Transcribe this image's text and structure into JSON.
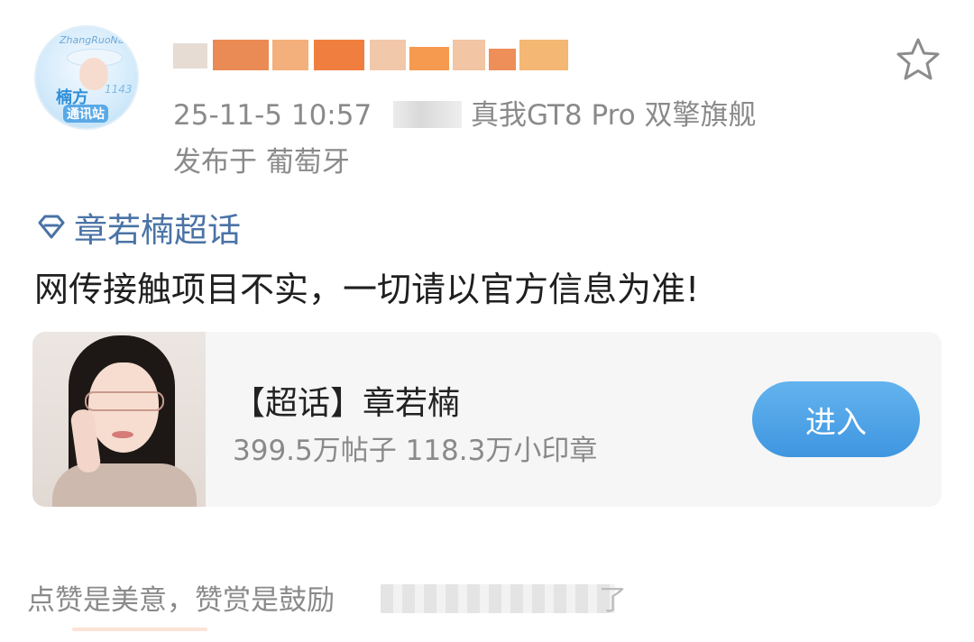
{
  "post": {
    "timestamp": "25-11-5 10:57",
    "device": "真我GT8 Pro 双擎旗舰",
    "location": "发布于 葡萄牙",
    "topic": "章若楠超话",
    "text": "网传接触项目不实，一切请以官方信息为准!"
  },
  "avatar": {
    "arc_text": "ZhangRuoNan",
    "badge_line1": "楠方",
    "badge_line2": "通讯站",
    "sticker": "1143"
  },
  "supertopic_card": {
    "title": "【超话】章若楠",
    "stats": "399.5万帖子 118.3万小印章",
    "enter_label": "进入"
  },
  "footer": {
    "slogan": "点赞是美意，赞赏是鼓励",
    "suffix": "了"
  },
  "icons": {
    "favorite": "star-outline-icon",
    "supertopic": "diamond-icon"
  },
  "colors": {
    "topic_link": "#4a73a6",
    "enter_button": "#4aa2e6",
    "meta_text": "#8a8a8a"
  }
}
